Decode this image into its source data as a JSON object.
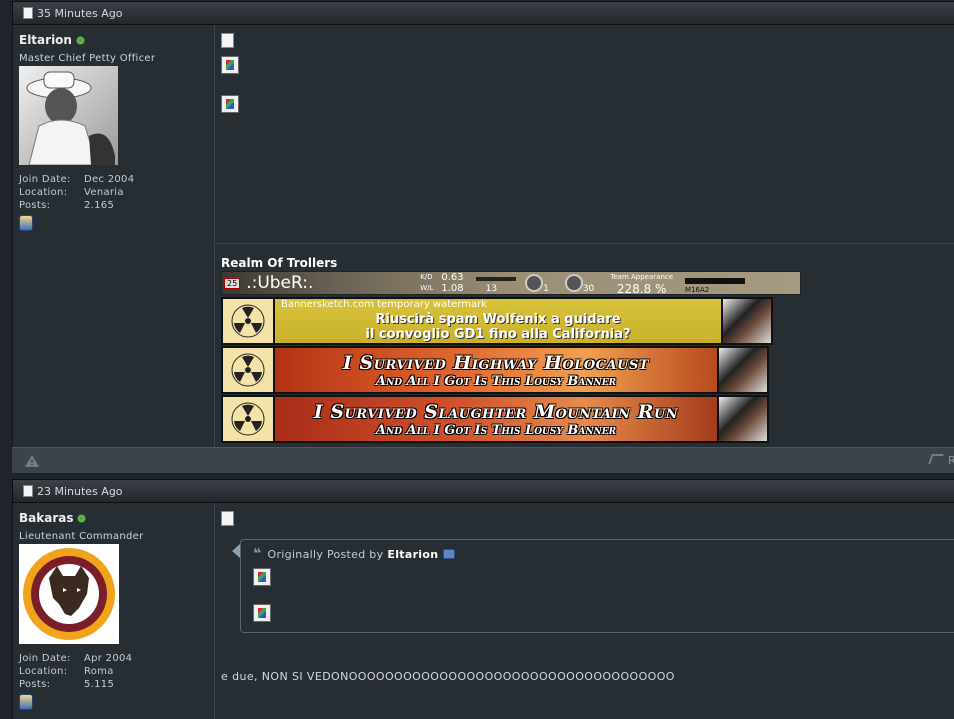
{
  "posts": [
    {
      "time": "35 Minutes Ago",
      "user": {
        "name": "Eltarion",
        "rank": "Master Chief Petty Officer",
        "join_label": "Join Date:",
        "join_value": "Dec 2004",
        "location_label": "Location:",
        "location_value": "Venaria",
        "posts_label": "Posts:",
        "posts_value": "2.165"
      },
      "signature": {
        "title": "Realm Of Trollers",
        "stats": {
          "level": "25",
          "name": ".:UbeR:.",
          "kd_label": "K/D",
          "kd": "0.63",
          "wl_label": "W/L",
          "wl": "1.08",
          "count1": "13",
          "count2": "1",
          "count3": "30",
          "team_label": "Team Appearance",
          "team_value": "228.8 %",
          "weapon": "M16A2"
        },
        "banners": [
          {
            "watermark": "Bannersketch.com temporary watermark",
            "line1": "Riuscirà spam Wolfenix a guidare",
            "line2": "il convoglio GD1 fino alla California?"
          },
          {
            "line1": "I Survived Highway Holocaust",
            "line2": "And All I Got Is This Lousy Banner"
          },
          {
            "line1": "I Survived Slaughter Mountain Run",
            "line2": "And All I Got Is This Lousy Banner"
          }
        ]
      },
      "footer_right": "R"
    },
    {
      "time": "23 Minutes Ago",
      "user": {
        "name": "Bakaras",
        "rank": "Lieutenant Commander",
        "join_label": "Join Date:",
        "join_value": "Apr 2004",
        "location_label": "Location:",
        "location_value": "Roma",
        "posts_label": "Posts:",
        "posts_value": "5.115"
      },
      "quote": {
        "prefix": "Originally Posted by",
        "author": "Eltarion"
      },
      "message": "e due, NON SI VEDONOOOOOOOOOOOOOOOOOOOOOOOOOOOOOOOOOOOO"
    }
  ]
}
